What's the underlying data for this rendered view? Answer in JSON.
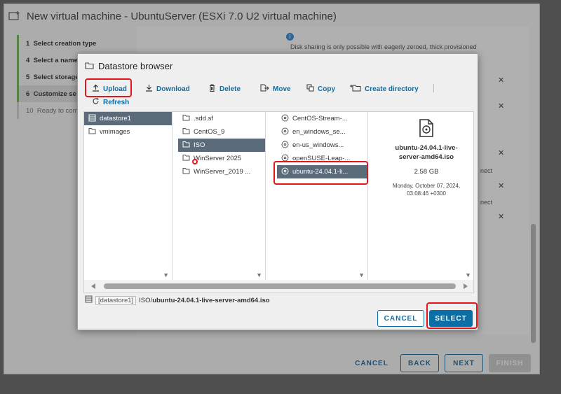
{
  "wizard": {
    "title": "New virtual machine - UbuntuServer (ESXi 7.0 U2 virtual machine)",
    "steps": [
      {
        "num": "1",
        "label": "Select creation type"
      },
      {
        "num": "4",
        "label": "Select a name"
      },
      {
        "num": "5",
        "label": "Select storage"
      },
      {
        "num": "6",
        "label": "Customize se"
      },
      {
        "num": "10",
        "label": "Ready to com"
      }
    ],
    "info_text": "Disk sharing is only possible with eagerly zeroed, thick provisioned",
    "side_texts": [
      "nect",
      "nect"
    ],
    "footer": {
      "cancel": "CANCEL",
      "back": "BACK",
      "next": "NEXT",
      "finish": "FINISH"
    }
  },
  "dialog": {
    "title": "Datastore browser",
    "toolbar": {
      "upload": "Upload",
      "download": "Download",
      "delete": "Delete",
      "move": "Move",
      "copy": "Copy",
      "create_directory": "Create directory",
      "refresh": "Refresh"
    },
    "columns": {
      "datastores": [
        "datastore1",
        "vmimages"
      ],
      "folders": [
        ".sdd.sf",
        "CentOS_9",
        "ISO",
        "WinServer 2025",
        "WinServer_2019 ..."
      ],
      "files": [
        "CentOS-Stream-...",
        "en_windows_se...",
        "en-us_windows...",
        "openSUSE-Leap-...",
        "ubuntu-24.04.1-li..."
      ]
    },
    "details": {
      "name_line1": "ubuntu-24.04.1-live-",
      "name_line2": "server-amd64.iso",
      "size": "2.58 GB",
      "date_line1": "Monday, October 07, 2024,",
      "date_line2": "03:08:46 +0300"
    },
    "path": {
      "datastore": "[datastore1]",
      "folder": "ISO/",
      "file": "ubuntu-24.04.1-live-server-amd64.iso"
    },
    "buttons": {
      "cancel": "CANCEL",
      "select": "SELECT"
    }
  },
  "colors": {
    "accent": "#0b6ea5",
    "highlight": "#e4161a",
    "selection": "#5b6b7a"
  }
}
